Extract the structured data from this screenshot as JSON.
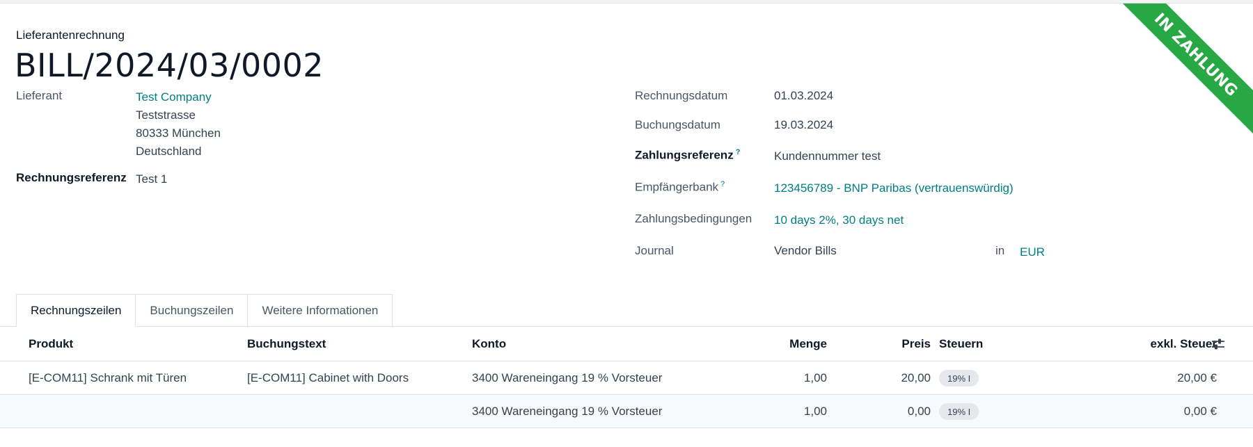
{
  "header": {
    "doc_type": "Lieferantenrechnung",
    "title": "BILL/2024/03/0002",
    "ribbon": "IN ZAHLUNG",
    "ribbon_color": "#28a745"
  },
  "left": {
    "vendor_label": "Lieferant",
    "vendor_name": "Test Company",
    "address_line1": "Teststrasse",
    "address_line2": "80333 München",
    "address_line3": "Deutschland",
    "ref_label": "Rechnungsreferenz",
    "ref_value": "Test 1"
  },
  "right": {
    "invoice_date_label": "Rechnungsdatum",
    "invoice_date": "01.03.2024",
    "booking_date_label": "Buchungsdatum",
    "booking_date": "19.03.2024",
    "payment_ref_label": "Zahlungsreferenz",
    "payment_ref": "Kundennummer test",
    "bank_label": "Empfängerbank",
    "bank": "123456789 - BNP Paribas (vertrauenswürdig)",
    "terms_label": "Zahlungsbedingungen",
    "terms": "10 days 2%, 30 days net",
    "journal_label": "Journal",
    "journal": "Vendor Bills",
    "in_label": "in",
    "currency": "EUR",
    "tooltip_mark": "?"
  },
  "tabs": [
    {
      "label": "Rechnungszeilen"
    },
    {
      "label": "Buchungszeilen"
    },
    {
      "label": "Weitere Informationen"
    }
  ],
  "table": {
    "columns": {
      "product": "Produkt",
      "text": "Buchungstext",
      "account": "Konto",
      "qty": "Menge",
      "price": "Preis",
      "taxes": "Steuern",
      "subtotal": "exkl. Steuer"
    },
    "rows": [
      {
        "product": "[E-COM11] Schrank mit Türen",
        "text": "[E-COM11] Cabinet with Doors",
        "account": "3400 Wareneingang 19 % Vorsteuer",
        "qty": "1,00",
        "price": "20,00",
        "tax": "19% I",
        "subtotal": "20,00 €"
      },
      {
        "product": "",
        "text": "",
        "account": "3400 Wareneingang 19 % Vorsteuer",
        "qty": "1,00",
        "price": "0,00",
        "tax": "19% I",
        "subtotal": "0,00 €"
      }
    ]
  },
  "colors": {
    "link": "#017e84",
    "accent_green": "#28a745"
  }
}
